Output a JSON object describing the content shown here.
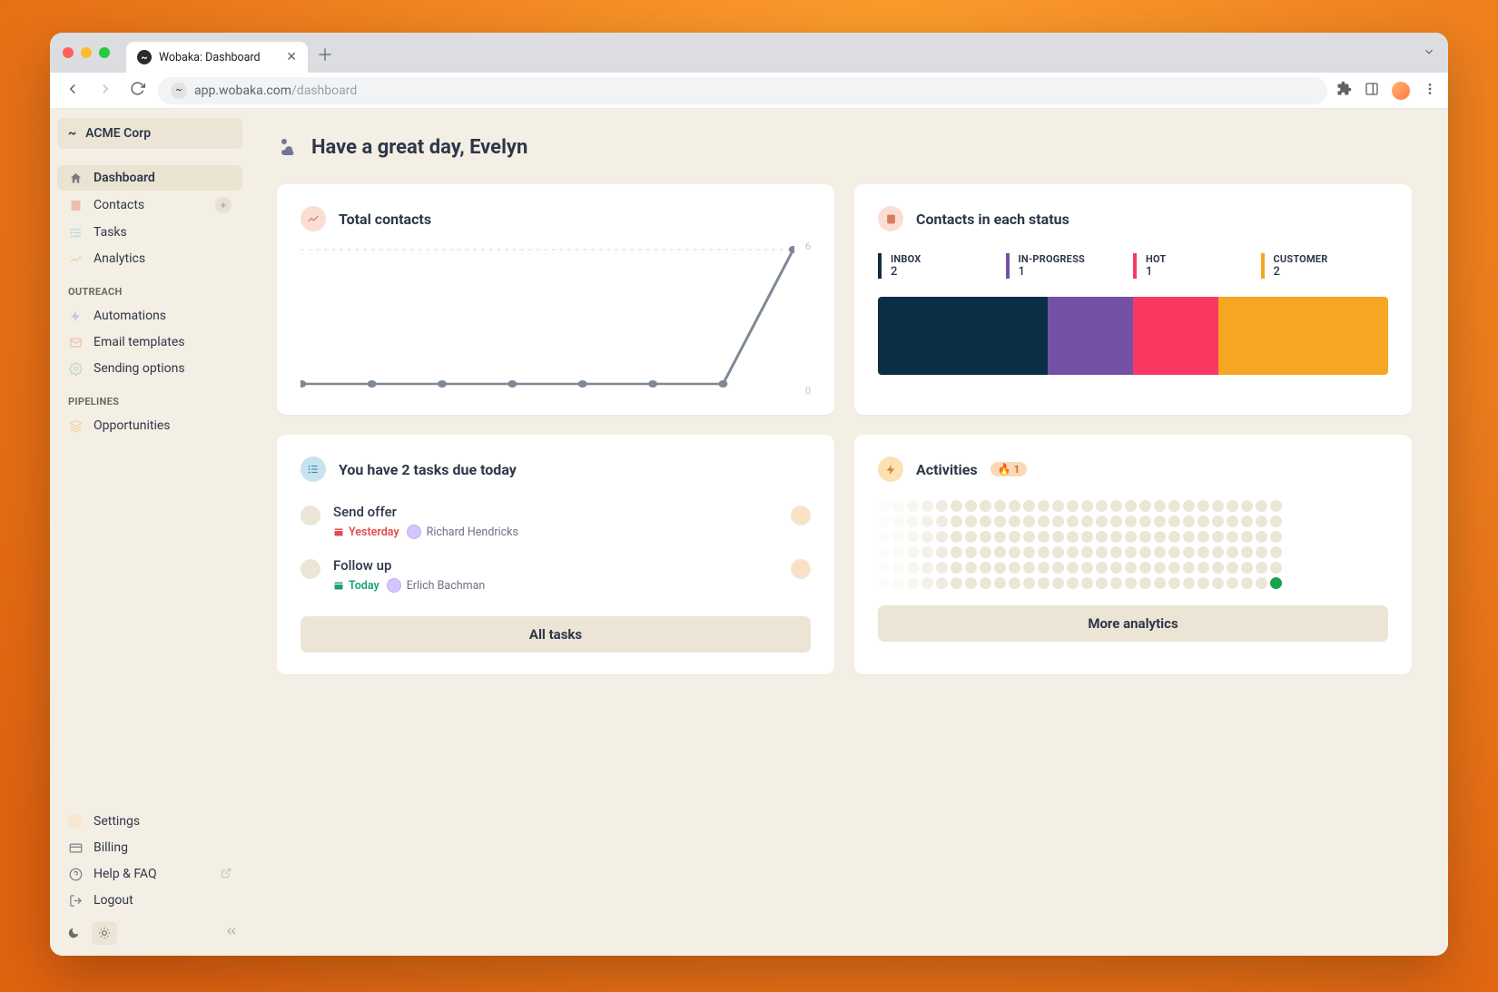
{
  "browser": {
    "tab_title": "Wobaka: Dashboard",
    "url_host": "app.wobaka.com",
    "url_path": "/dashboard"
  },
  "org": {
    "name": "ACME Corp"
  },
  "sidebar": {
    "main": [
      {
        "label": "Dashboard",
        "icon": "home",
        "active": true
      },
      {
        "label": "Contacts",
        "icon": "contacts",
        "badge": "+"
      },
      {
        "label": "Tasks",
        "icon": "tasks"
      },
      {
        "label": "Analytics",
        "icon": "analytics"
      }
    ],
    "outreach_heading": "OUTREACH",
    "outreach": [
      {
        "label": "Automations",
        "icon": "bolt"
      },
      {
        "label": "Email templates",
        "icon": "mail"
      },
      {
        "label": "Sending options",
        "icon": "gear"
      }
    ],
    "pipelines_heading": "PIPELINES",
    "pipelines": [
      {
        "label": "Opportunities",
        "icon": "layers"
      }
    ],
    "bottom": [
      {
        "label": "Settings",
        "icon": "avatar"
      },
      {
        "label": "Billing",
        "icon": "card"
      },
      {
        "label": "Help & FAQ",
        "icon": "help",
        "external": true
      },
      {
        "label": "Logout",
        "icon": "logout"
      }
    ]
  },
  "header": {
    "greeting": "Have a great day, Evelyn"
  },
  "cards": {
    "total_contacts": {
      "title": "Total contacts",
      "ymax_label": "6",
      "ymin_label": "0"
    },
    "status": {
      "title": "Contacts in each status",
      "items": [
        {
          "label": "INBOX",
          "value": "2",
          "color": "#0a2e45"
        },
        {
          "label": "IN-PROGRESS",
          "value": "1",
          "color": "#7352a6"
        },
        {
          "label": "HOT",
          "value": "1",
          "color": "#fa3862"
        },
        {
          "label": "CUSTOMER",
          "value": "2",
          "color": "#f5a623"
        }
      ]
    },
    "tasks": {
      "title": "You have 2 tasks due today",
      "items": [
        {
          "title": "Send offer",
          "date_label": "Yesterday",
          "date_tone": "red",
          "contact": "Richard Hendricks"
        },
        {
          "title": "Follow up",
          "date_label": "Today",
          "date_tone": "green",
          "contact": "Erlich Bachman"
        }
      ],
      "cta": "All tasks"
    },
    "activities": {
      "title": "Activities",
      "badge": "1",
      "cta": "More analytics"
    }
  },
  "chart_data": {
    "type": "line",
    "title": "Total contacts",
    "xlabel": "",
    "ylabel": "",
    "ylim": [
      0,
      6
    ],
    "x": [
      0,
      1,
      2,
      3,
      4,
      5,
      6,
      7
    ],
    "values": [
      0,
      0,
      0,
      0,
      0,
      0,
      0,
      6
    ],
    "y_ticks": [
      0,
      6
    ]
  }
}
